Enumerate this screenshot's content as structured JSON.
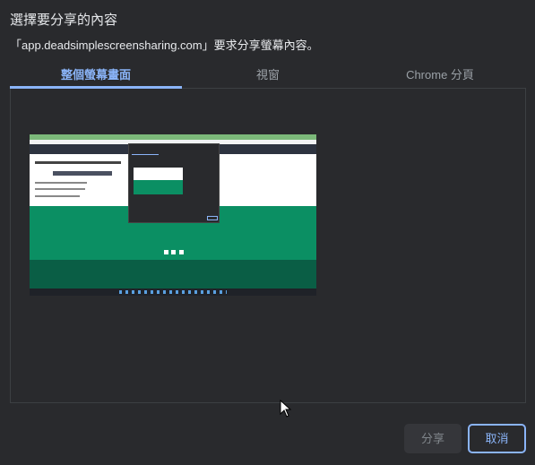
{
  "dialog": {
    "title": "選擇要分享的內容",
    "subtitle": "「app.deadsimplescreensharing.com」要求分享螢幕內容。",
    "tabs": [
      {
        "label": "整個螢幕畫面",
        "active": true
      },
      {
        "label": "視窗",
        "active": false
      },
      {
        "label": "Chrome 分頁",
        "active": false
      }
    ],
    "share_label": "分享",
    "cancel_label": "取消"
  },
  "colors": {
    "accent": "#8ab4f8",
    "background": "#292a2d",
    "thumb_green": "#0b8f63",
    "thumb_dark_green": "#0a5e45"
  }
}
